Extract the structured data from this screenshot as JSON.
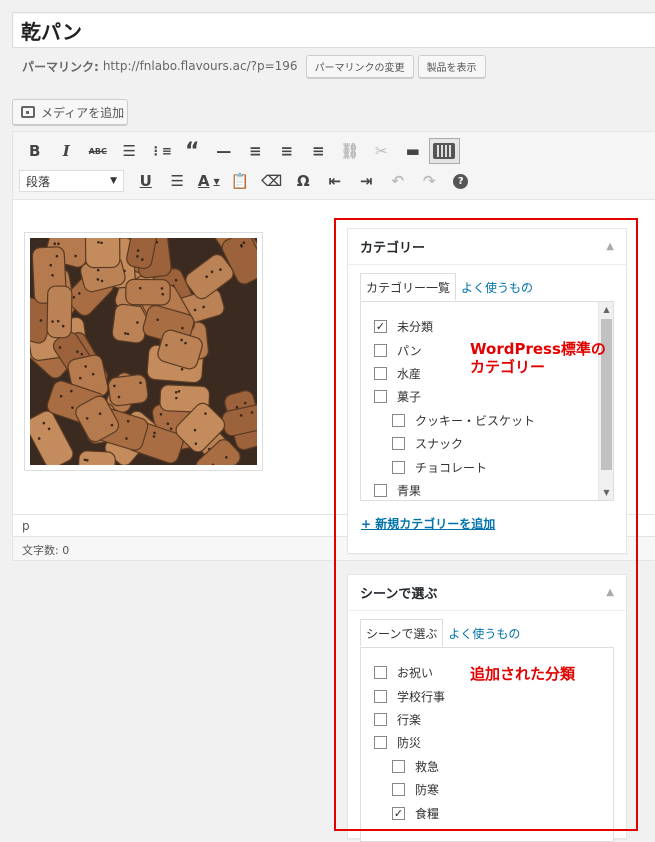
{
  "post": {
    "title": "乾パン",
    "permalink_label": "パーマリンク:",
    "permalink_url": "http://fnlabo.flavours.ac/?p=196",
    "change_permalink_btn": "パーマリンクの変更",
    "view_product_btn": "製品を表示"
  },
  "media": {
    "add_media_label": "メディアを追加"
  },
  "toolbar": {
    "row1": [
      "bold-icon",
      "italic-icon",
      "strikethrough-icon",
      "bullet-list-icon",
      "numbered-list-icon",
      "blockquote-icon",
      "horizontal-rule-icon",
      "align-left-icon",
      "align-center-icon",
      "align-right-icon",
      "insert-link-icon",
      "unlink-icon",
      "read-more-icon",
      "toolbar-toggle-icon"
    ],
    "row2": [
      "underline-icon",
      "justify-icon",
      "text-color-icon",
      "paste-as-text-icon",
      "clear-formatting-icon",
      "special-character-icon",
      "outdent-icon",
      "indent-icon",
      "undo-icon",
      "redo-icon",
      "help-icon"
    ],
    "format_select": "段落"
  },
  "editor": {
    "path": "p",
    "word_count": "文字数: 0"
  },
  "categories": {
    "title": "カテゴリー",
    "tabs": [
      "カテゴリー一覧",
      "よく使うもの"
    ],
    "items": [
      {
        "label": "未分類",
        "checked": true,
        "level": 0
      },
      {
        "label": "パン",
        "checked": false,
        "level": 0
      },
      {
        "label": "水産",
        "checked": false,
        "level": 0
      },
      {
        "label": "菓子",
        "checked": false,
        "level": 0
      },
      {
        "label": "クッキー・ビスケット",
        "checked": false,
        "level": 1
      },
      {
        "label": "スナック",
        "checked": false,
        "level": 1
      },
      {
        "label": "チョコレート",
        "checked": false,
        "level": 1
      },
      {
        "label": "青果",
        "checked": false,
        "level": 0
      }
    ],
    "add_new": "+ 新規カテゴリーを追加",
    "annotation_line1": "WordPress標準の",
    "annotation_line2": "カテゴリー"
  },
  "scenes": {
    "title": "シーンで選ぶ",
    "tabs": [
      "シーンで選ぶ",
      "よく使うもの"
    ],
    "items": [
      {
        "label": "お祝い",
        "checked": false,
        "level": 0
      },
      {
        "label": "学校行事",
        "checked": false,
        "level": 0
      },
      {
        "label": "行楽",
        "checked": false,
        "level": 0
      },
      {
        "label": "防災",
        "checked": false,
        "level": 0
      },
      {
        "label": "救急",
        "checked": false,
        "level": 1
      },
      {
        "label": "防寒",
        "checked": false,
        "level": 1
      },
      {
        "label": "食糧",
        "checked": true,
        "level": 1
      }
    ],
    "annotation": "追加された分類"
  },
  "colors": {
    "accent": "#0073aa",
    "annotation_red": "#e30000"
  }
}
